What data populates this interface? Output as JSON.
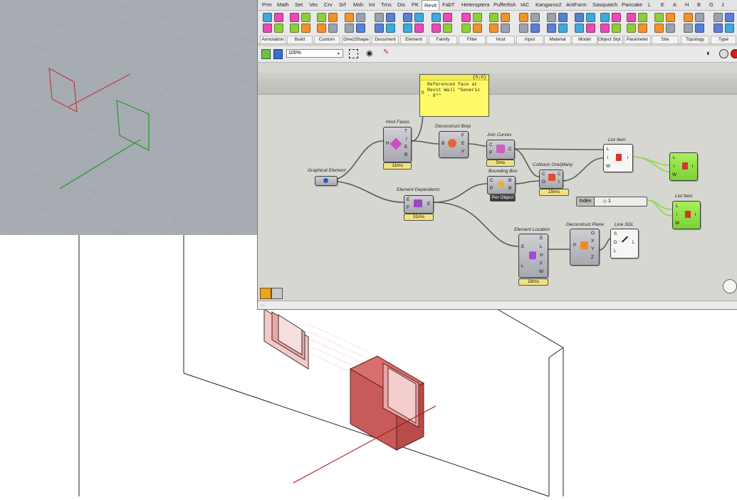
{
  "rhino_viewport": {
    "axes": {
      "x_color": "#c23b3b",
      "y_color": "#1f9b1f"
    }
  },
  "grasshopper": {
    "tabs": [
      "Prm",
      "Math",
      "Set",
      "Vec",
      "Crv",
      "Srf",
      "Msh",
      "Int",
      "Trns",
      "Dis",
      "PK",
      "Revit",
      "FabT",
      "Heteroptera",
      "Pufferfish",
      "IAC",
      "Kangaroo2",
      "AntFarm",
      "Sasquatch",
      "Pancake",
      "L",
      "E",
      "A",
      "H",
      "B",
      "G",
      "J"
    ],
    "active_tab": "Revit",
    "ribbon_groups": [
      "Annotation",
      "Build",
      "Custom",
      "DirectShape",
      "Document",
      "Element",
      "Family",
      "Filter",
      "Host",
      "Input",
      "Material",
      "Model",
      "Object Styl...",
      "Parameter",
      "Site",
      "Topology",
      "Type"
    ],
    "zoom": "100%",
    "status_text": "...",
    "colors": {
      "canvas": "#d7d7d2",
      "panel": "#fffb66",
      "green": "#8fde45",
      "wire": "#5a5a5a",
      "wire_green": "#9ad55a"
    },
    "panel": {
      "header": "{0;0}",
      "index": "0",
      "text": "Referenced face at Revit Wall \"Generic - 8\"\""
    },
    "components": {
      "graphical_element": {
        "title": "Graphical Element"
      },
      "host_faces": {
        "title": "Host Faces",
        "inputs": [
          "H"
        ],
        "outputs": [
          "T",
          "I",
          "E",
          "B"
        ],
        "time": "11ms"
      },
      "deconstruct_brep": {
        "title": "Deconstruct Brep",
        "inputs": [
          "B"
        ],
        "outputs": [
          "F",
          "E",
          "V"
        ]
      },
      "join_curves": {
        "title": "Join Curves",
        "inputs": [
          "C",
          "P"
        ],
        "outputs": [
          "C"
        ],
        "time": "5ms"
      },
      "list_item_1": {
        "title": "List Item",
        "inputs": [
          "L",
          "i",
          "W"
        ],
        "outputs": [
          "i"
        ]
      },
      "list_item_2": {
        "title": "List Item",
        "inputs": [
          "L",
          "i",
          "W"
        ],
        "outputs": [
          "i"
        ]
      },
      "list_item_3": {
        "title": "List Item",
        "inputs": [
          "L",
          "i",
          "W"
        ],
        "outputs": [
          "i"
        ]
      },
      "collision": {
        "title": "Collision One|Many",
        "inputs": [
          "C",
          "O"
        ],
        "outputs": [
          "C",
          "I"
        ],
        "time": "15ms"
      },
      "bounding_box": {
        "title": "Bounding Box",
        "inputs": [
          "C",
          "P"
        ],
        "outputs": [
          "B",
          "B"
        ],
        "mode": "Per Object"
      },
      "element_dependents": {
        "title": "Element Dependents",
        "inputs": [
          "E",
          "F"
        ],
        "outputs": [
          "E"
        ],
        "time": "31ms"
      },
      "element_location": {
        "title": "Element Location",
        "inputs": [
          "E",
          "L"
        ],
        "outputs": [
          "E",
          "L",
          "H",
          "F",
          "W"
        ],
        "time": "18ms"
      },
      "deconstruct_plane": {
        "title": "Deconstruct Plane",
        "inputs": [
          "P"
        ],
        "outputs": [
          "O",
          "X",
          "Y",
          "Z"
        ]
      },
      "line_sdl": {
        "title": "Line SDL",
        "inputs": [
          "S",
          "D",
          "L"
        ],
        "outputs": [
          "L"
        ]
      }
    },
    "slider": {
      "label": "Index",
      "value": "1"
    }
  }
}
